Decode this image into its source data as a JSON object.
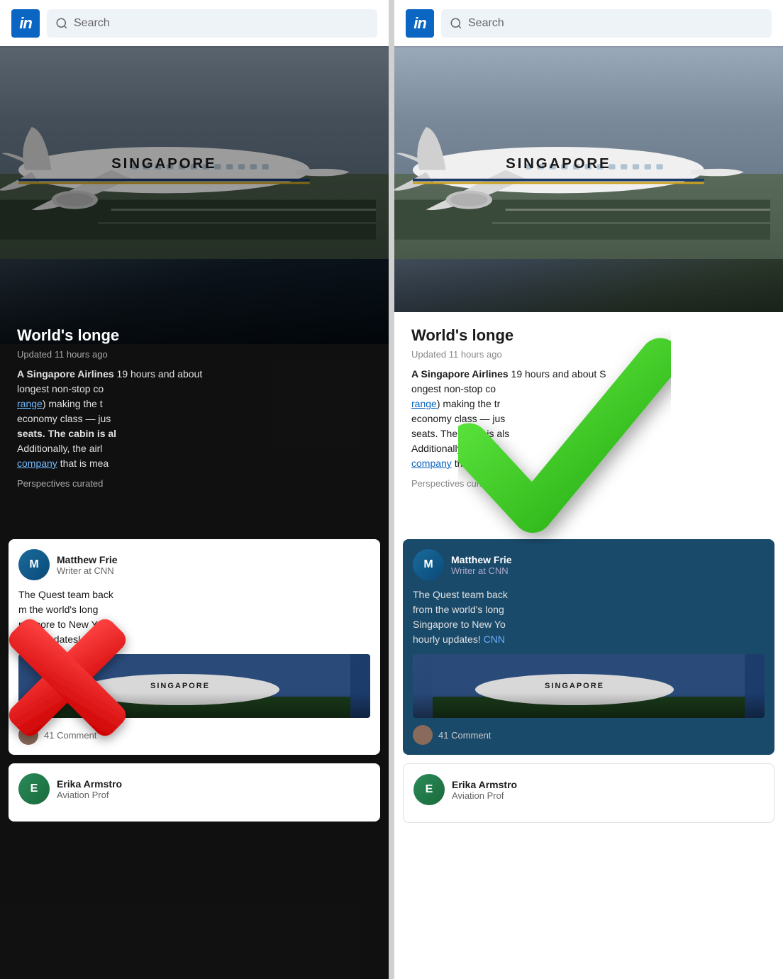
{
  "left_panel": {
    "header": {
      "logo_text": "in",
      "search_placeholder": "Search"
    },
    "article": {
      "title": "World's longe",
      "updated": "Updated 11 hours ago",
      "body_parts": [
        {
          "text": "A Singapore Airlines ",
          "bold": false
        },
        {
          "text": "19 hours and about ",
          "bold": false
        },
        {
          "text": "longest non-stop co",
          "bold": false
        },
        {
          "text": "range",
          "bold": false,
          "link": true
        },
        {
          "text": ") making the t",
          "bold": false
        },
        {
          "text": "economy class — jus",
          "bold": false
        },
        {
          "text": "seats. The cabin is al",
          "bold": true
        },
        {
          "text": "Additionally, the airl",
          "bold": false
        },
        {
          "text": "company",
          "bold": false,
          "link": true
        },
        {
          "text": " that is mea",
          "bold": false
        }
      ],
      "perspectives": "Perspectives curated"
    },
    "cards": [
      {
        "author": "Matthew Frie",
        "role": "Writer at CNN",
        "text": "The Quest team back",
        "text2": "m the world's long",
        "text3": "ngapore to New Yo",
        "text4": "ourly updates!",
        "link_text": "CNN",
        "has_image": true,
        "comments_count": "41 Comment"
      },
      {
        "author": "Erika Armstro",
        "role": "Aviation Prof",
        "text": ""
      }
    ]
  },
  "right_panel": {
    "header": {
      "logo_text": "in",
      "search_placeholder": "Search"
    },
    "article": {
      "title": "World's longe",
      "updated": "Updated 11 hours ago",
      "body_parts": [
        {
          "text": "A Singapore Airlines ",
          "bold": false
        },
        {
          "text": "19 hours and about S",
          "bold": false
        },
        {
          "text": "ongest non-stop co",
          "bold": false
        },
        {
          "text": "range",
          "bold": false,
          "link": true
        },
        {
          "text": ") making the tr",
          "bold": false
        },
        {
          "text": "economy class — jus",
          "bold": false
        },
        {
          "text": "seats. The cabin is als",
          "bold": false
        },
        {
          "text": "Additionally, the airli",
          "bold": false
        },
        {
          "text": "company",
          "bold": false,
          "link": true
        },
        {
          "text": " that is mea",
          "bold": false
        }
      ],
      "perspectives": "Perspectives curated"
    },
    "cards": [
      {
        "author": "Matthew Frie",
        "role": "Writer at CNN",
        "text": "The Quest team back",
        "text2": "from the world's long",
        "text3": "Singapore to New Yo",
        "text4": "hourly updates!",
        "link_text": "CNN",
        "has_image": true,
        "comments_count": "41 Comment"
      },
      {
        "author": "Erika Armstro",
        "role": "Aviation Prof",
        "text": ""
      }
    ]
  },
  "overlay": {
    "left_has_red_x": true,
    "right_has_green_check": true
  }
}
